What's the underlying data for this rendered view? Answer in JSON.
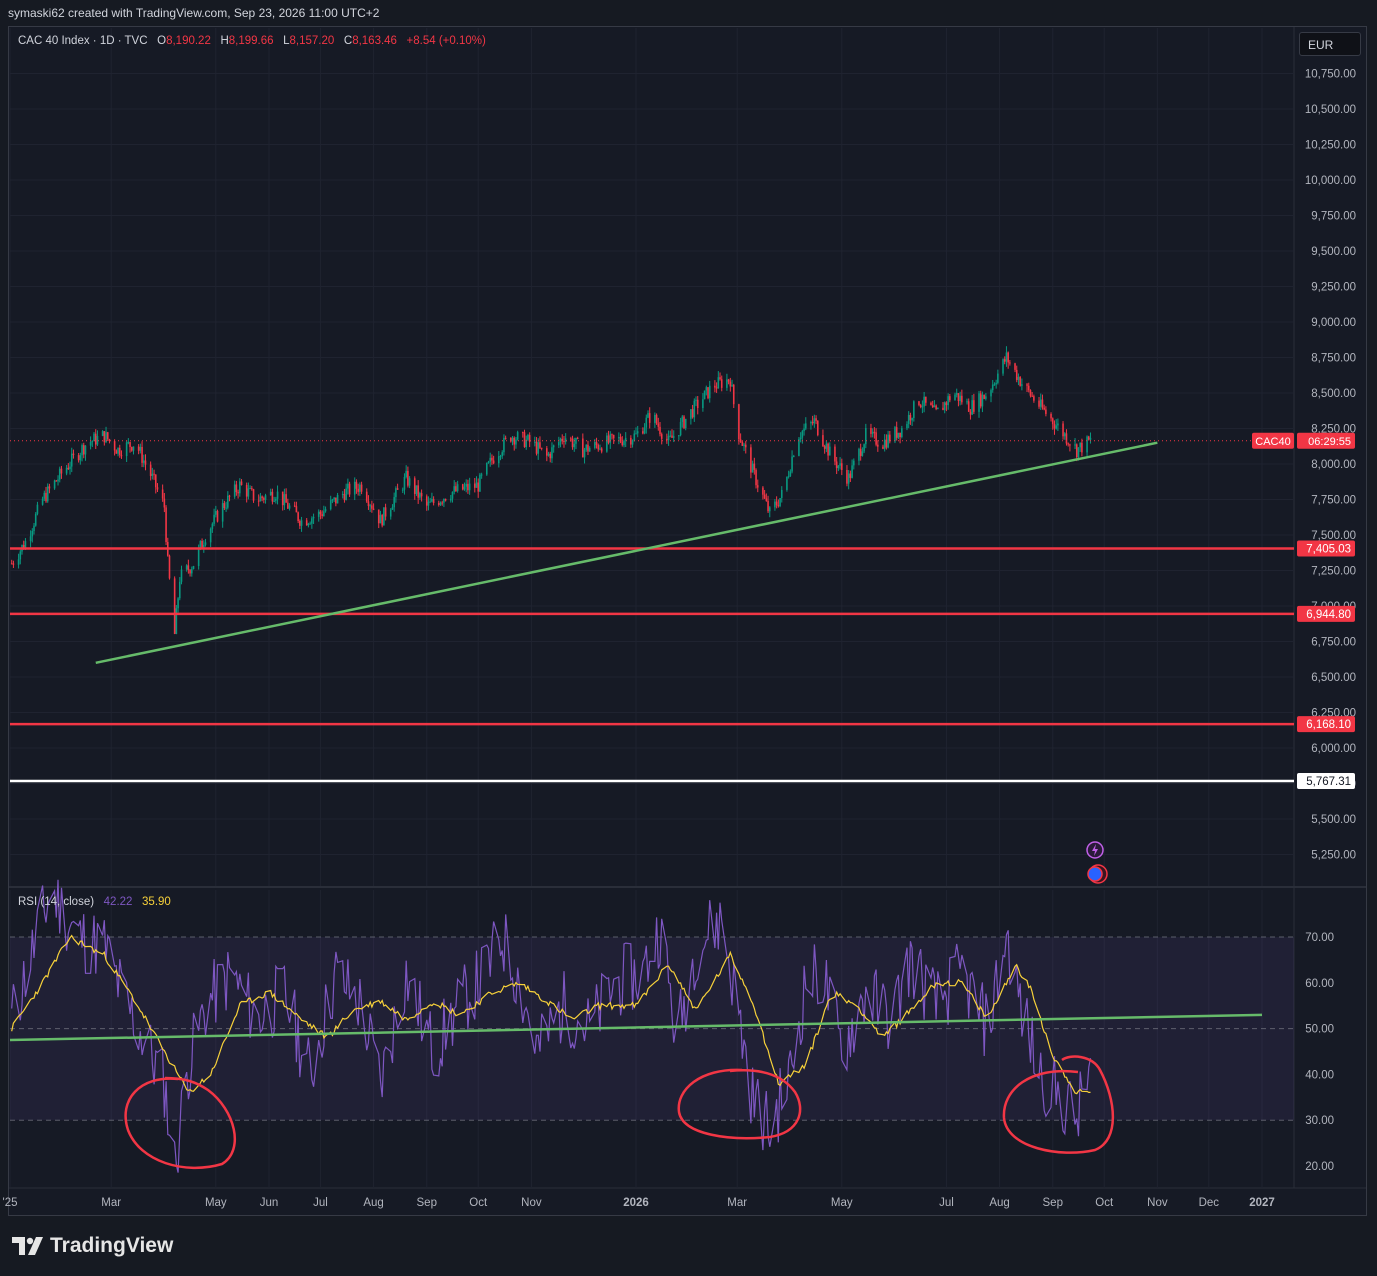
{
  "header": {
    "attribution": "symaski62 created with TradingView.com, Sep 23, 2026 11:00 UTC+2"
  },
  "legend": {
    "symbol": "CAC 40 Index · 1D · TVC",
    "o_label": "O",
    "o_value": "8,190.22",
    "h_label": "H",
    "h_value": "8,199.66",
    "l_label": "L",
    "l_value": "8,157.20",
    "c_label": "C",
    "c_value": "8,163.46",
    "change": "+8.54 (+0.10%)"
  },
  "currency": "EUR",
  "rsi_legend": {
    "name": "RSI (14, close)",
    "rsi_value": "42.22",
    "ma_value": "35.90"
  },
  "branding": "TradingView",
  "colors": {
    "up": "#089981",
    "down": "#f23645",
    "support_lines": "#f23645",
    "base_line": "#ffffff",
    "trendline": "#66bb6a",
    "rsi": "#7e57c2",
    "rsi_ma": "#f7d13a",
    "annotation_circles": "#f23645"
  },
  "chart_data": [
    {
      "type": "candlestick",
      "title": "CAC 40 Index · 1D · TVC",
      "y_axis_ticks": [
        "5,250.00",
        "5,500.00",
        "5,750.00",
        "6,000.00",
        "6,250.00",
        "6,500.00",
        "6,750.00",
        "7,000.00",
        "7,250.00",
        "7,500.00",
        "7,750.00",
        "8,000.00",
        "8,250.00",
        "8,500.00",
        "8,750.00",
        "9,000.00",
        "9,250.00",
        "9,500.00",
        "9,750.00",
        "10,000.00",
        "10,250.00",
        "10,500.00",
        "10,750.00"
      ],
      "y_tick_values": [
        5250,
        5500,
        5750,
        6000,
        6250,
        6500,
        6750,
        7000,
        7250,
        7500,
        7750,
        8000,
        8250,
        8500,
        8750,
        9000,
        9250,
        9500,
        9750,
        10000,
        10250,
        10500,
        10750
      ],
      "ylim": [
        5100,
        10900
      ],
      "x_axis_ticks": [
        "'25",
        "Mar",
        "May",
        "Jun",
        "Jul",
        "Aug",
        "Sep",
        "Oct",
        "Nov",
        "2026",
        "Mar",
        "May",
        "Jul",
        "Aug",
        "Sep",
        "Oct",
        "Nov",
        "Dec",
        "2027"
      ],
      "x_tick_dates": [
        "2025-01-01",
        "2025-03-01",
        "2025-05-01",
        "2025-06-01",
        "2025-07-01",
        "2025-08-01",
        "2025-09-01",
        "2025-10-01",
        "2025-11-01",
        "2026-01-01",
        "2026-03-01",
        "2026-05-01",
        "2026-07-01",
        "2026-08-01",
        "2026-09-01",
        "2026-10-01",
        "2026-11-01",
        "2026-12-01",
        "2027-01-01"
      ],
      "xlim": [
        "2025-01-01",
        "2027-01-15"
      ],
      "close_path": [
        [
          "2025-01-02",
          7300
        ],
        [
          "2025-01-10",
          7450
        ],
        [
          "2025-01-20",
          7750
        ],
        [
          "2025-02-01",
          7950
        ],
        [
          "2025-02-15",
          8150
        ],
        [
          "2025-02-25",
          8200
        ],
        [
          "2025-03-05",
          8100
        ],
        [
          "2025-03-15",
          8150
        ],
        [
          "2025-03-25",
          7900
        ],
        [
          "2025-04-01",
          7700
        ],
        [
          "2025-04-03",
          7300
        ],
        [
          "2025-04-07",
          6800
        ],
        [
          "2025-04-10",
          7200
        ],
        [
          "2025-04-18",
          7300
        ],
        [
          "2025-04-25",
          7500
        ],
        [
          "2025-05-05",
          7700
        ],
        [
          "2025-05-15",
          7850
        ],
        [
          "2025-05-25",
          7750
        ],
        [
          "2025-06-05",
          7800
        ],
        [
          "2025-06-20",
          7600
        ],
        [
          "2025-07-01",
          7650
        ],
        [
          "2025-07-15",
          7800
        ],
        [
          "2025-07-25",
          7850
        ],
        [
          "2025-08-05",
          7600
        ],
        [
          "2025-08-20",
          7900
        ],
        [
          "2025-09-01",
          7700
        ],
        [
          "2025-09-15",
          7800
        ],
        [
          "2025-10-01",
          7850
        ],
        [
          "2025-10-10",
          8050
        ],
        [
          "2025-10-20",
          8200
        ],
        [
          "2025-11-01",
          8150
        ],
        [
          "2025-11-10",
          8050
        ],
        [
          "2025-11-20",
          8200
        ],
        [
          "2025-12-01",
          8100
        ],
        [
          "2025-12-15",
          8150
        ],
        [
          "2026-01-01",
          8200
        ],
        [
          "2026-01-10",
          8350
        ],
        [
          "2026-01-20",
          8150
        ],
        [
          "2026-02-01",
          8350
        ],
        [
          "2026-02-15",
          8550
        ],
        [
          "2026-02-25",
          8600
        ],
        [
          "2026-03-01",
          8250
        ],
        [
          "2026-03-10",
          7950
        ],
        [
          "2026-03-20",
          7650
        ],
        [
          "2026-03-28",
          7800
        ],
        [
          "2026-04-05",
          8200
        ],
        [
          "2026-04-15",
          8300
        ],
        [
          "2026-04-25",
          8050
        ],
        [
          "2026-05-05",
          7900
        ],
        [
          "2026-05-15",
          8200
        ],
        [
          "2026-05-25",
          8150
        ],
        [
          "2026-06-05",
          8250
        ],
        [
          "2026-06-15",
          8450
        ],
        [
          "2026-06-25",
          8350
        ],
        [
          "2026-07-05",
          8500
        ],
        [
          "2026-07-15",
          8400
        ],
        [
          "2026-07-25",
          8500
        ],
        [
          "2026-08-05",
          8750
        ],
        [
          "2026-08-15",
          8550
        ],
        [
          "2026-08-25",
          8400
        ],
        [
          "2026-09-05",
          8250
        ],
        [
          "2026-09-15",
          8100
        ],
        [
          "2026-09-23",
          8163
        ]
      ],
      "horizontal_levels": [
        {
          "value": 7405.03,
          "label": "7,405.03",
          "color": "#f23645"
        },
        {
          "value": 6944.8,
          "label": "6,944.80",
          "color": "#f23645"
        },
        {
          "value": 6168.1,
          "label": "6,168.10",
          "color": "#f23645"
        },
        {
          "value": 5767.31,
          "label": "5,767.31",
          "color": "#ffffff"
        }
      ],
      "current_price": {
        "value": 8163.46,
        "symbol_label": "CAC40",
        "countdown": "06:29:55"
      },
      "trendline": {
        "start": [
          "2025-02-20",
          6600
        ],
        "end": [
          "2026-11-01",
          8150
        ]
      }
    },
    {
      "type": "line",
      "title": "RSI (14, close)",
      "y_axis_ticks": [
        "20.00",
        "30.00",
        "40.00",
        "50.00",
        "60.00",
        "70.00"
      ],
      "y_tick_values": [
        20,
        30,
        40,
        50,
        60,
        70
      ],
      "ylim": [
        17,
        80
      ],
      "band": [
        30,
        70
      ],
      "series": [
        {
          "name": "RSI",
          "color": "#7e57c2",
          "values_path": [
            [
              "2025-01-02",
              52
            ],
            [
              "2025-01-15",
              68
            ],
            [
              "2025-01-25",
              80
            ],
            [
              "2025-02-10",
              70
            ],
            [
              "2025-02-25",
              68
            ],
            [
              "2025-03-10",
              55
            ],
            [
              "2025-03-20",
              48
            ],
            [
              "2025-04-01",
              38
            ],
            [
              "2025-04-07",
              20
            ],
            [
              "2025-04-15",
              42
            ],
            [
              "2025-04-25",
              55
            ],
            [
              "2025-05-10",
              62
            ],
            [
              "2025-05-25",
              52
            ],
            [
              "2025-06-10",
              58
            ],
            [
              "2025-06-25",
              40
            ],
            [
              "2025-07-10",
              62
            ],
            [
              "2025-07-25",
              55
            ],
            [
              "2025-08-05",
              38
            ],
            [
              "2025-08-20",
              62
            ],
            [
              "2025-09-05",
              45
            ],
            [
              "2025-09-20",
              55
            ],
            [
              "2025-10-05",
              62
            ],
            [
              "2025-10-15",
              70
            ],
            [
              "2025-10-25",
              60
            ],
            [
              "2025-11-05",
              45
            ],
            [
              "2025-11-20",
              55
            ],
            [
              "2025-12-05",
              50
            ],
            [
              "2025-12-20",
              60
            ],
            [
              "2026-01-05",
              62
            ],
            [
              "2026-01-15",
              72
            ],
            [
              "2026-01-25",
              48
            ],
            [
              "2026-02-05",
              68
            ],
            [
              "2026-02-20",
              74
            ],
            [
              "2026-03-01",
              55
            ],
            [
              "2026-03-10",
              35
            ],
            [
              "2026-03-20",
              28
            ],
            [
              "2026-04-01",
              40
            ],
            [
              "2026-04-10",
              60
            ],
            [
              "2026-04-20",
              62
            ],
            [
              "2026-05-01",
              45
            ],
            [
              "2026-05-15",
              58
            ],
            [
              "2026-05-30",
              52
            ],
            [
              "2026-06-10",
              65
            ],
            [
              "2026-06-25",
              55
            ],
            [
              "2026-07-10",
              62
            ],
            [
              "2026-07-25",
              50
            ],
            [
              "2026-08-05",
              70
            ],
            [
              "2026-08-15",
              52
            ],
            [
              "2026-08-25",
              40
            ],
            [
              "2026-09-05",
              35
            ],
            [
              "2026-09-15",
              30
            ],
            [
              "2026-09-23",
              42
            ]
          ]
        },
        {
          "name": "RSI MA",
          "color": "#f7d13a",
          "values_path": [
            [
              "2025-01-02",
              50
            ],
            [
              "2025-01-20",
              60
            ],
            [
              "2025-02-05",
              70
            ],
            [
              "2025-02-25",
              66
            ],
            [
              "2025-03-15",
              56
            ],
            [
              "2025-04-01",
              45
            ],
            [
              "2025-04-15",
              36
            ],
            [
              "2025-04-28",
              40
            ],
            [
              "2025-05-15",
              55
            ],
            [
              "2025-06-01",
              58
            ],
            [
              "2025-06-20",
              52
            ],
            [
              "2025-07-05",
              48
            ],
            [
              "2025-07-20",
              54
            ],
            [
              "2025-08-05",
              56
            ],
            [
              "2025-08-20",
              52
            ],
            [
              "2025-09-05",
              56
            ],
            [
              "2025-09-20",
              53
            ],
            [
              "2025-10-10",
              58
            ],
            [
              "2025-10-25",
              60
            ],
            [
              "2025-11-10",
              56
            ],
            [
              "2025-11-25",
              52
            ],
            [
              "2025-12-10",
              55
            ],
            [
              "2026-01-01",
              55
            ],
            [
              "2026-01-20",
              64
            ],
            [
              "2026-02-05",
              54
            ],
            [
              "2026-02-25",
              66
            ],
            [
              "2026-03-10",
              56
            ],
            [
              "2026-03-25",
              38
            ],
            [
              "2026-04-10",
              42
            ],
            [
              "2026-04-25",
              58
            ],
            [
              "2026-05-10",
              55
            ],
            [
              "2026-05-25",
              48
            ],
            [
              "2026-06-10",
              54
            ],
            [
              "2026-06-25",
              60
            ],
            [
              "2026-07-10",
              60
            ],
            [
              "2026-07-25",
              52
            ],
            [
              "2026-08-10",
              64
            ],
            [
              "2026-08-20",
              58
            ],
            [
              "2026-09-01",
              44
            ],
            [
              "2026-09-15",
              36
            ],
            [
              "2026-09-23",
              36
            ]
          ]
        }
      ],
      "trendline": {
        "start": [
          "2025-01-01",
          47.5
        ],
        "end": [
          "2027-01-01",
          53
        ]
      },
      "annotations": [
        "circle-apr-2025",
        "circle-mar-2026",
        "circle-sep-2026"
      ]
    }
  ]
}
